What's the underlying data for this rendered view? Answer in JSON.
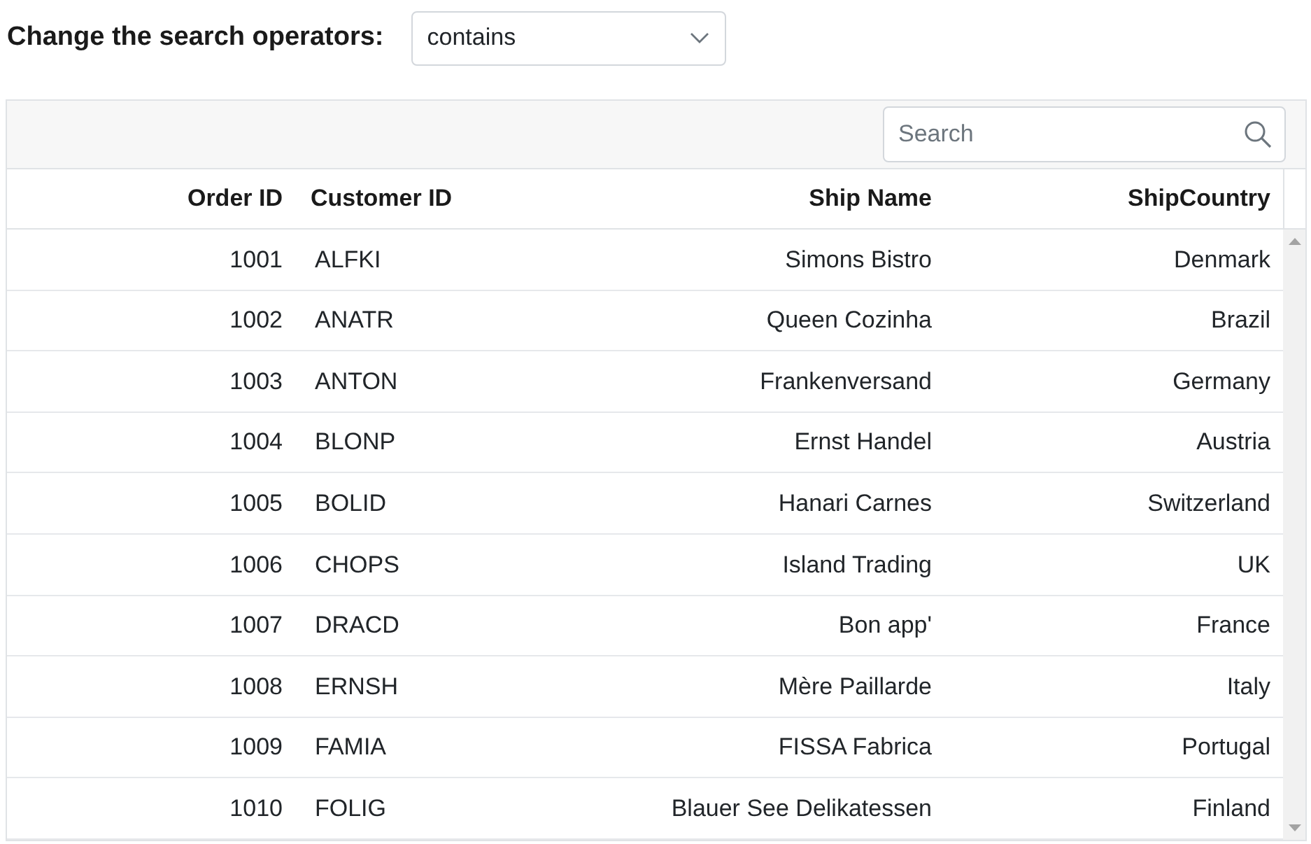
{
  "operator_selector": {
    "label": "Change the search operators:",
    "value": "contains"
  },
  "grid": {
    "search": {
      "placeholder": "Search"
    },
    "columns": [
      {
        "label": "Order ID"
      },
      {
        "label": "Customer ID"
      },
      {
        "label": "Ship Name"
      },
      {
        "label": "ShipCountry"
      }
    ],
    "rows": [
      [
        "1001",
        "ALFKI",
        "Simons Bistro",
        "Denmark"
      ],
      [
        "1002",
        "ANATR",
        "Queen Cozinha",
        "Brazil"
      ],
      [
        "1003",
        "ANTON",
        "Frankenversand",
        "Germany"
      ],
      [
        "1004",
        "BLONP",
        "Ernst Handel",
        "Austria"
      ],
      [
        "1005",
        "BOLID",
        "Hanari Carnes",
        "Switzerland"
      ],
      [
        "1006",
        "CHOPS",
        "Island Trading",
        "UK"
      ],
      [
        "1007",
        "DRACD",
        "Bon app'",
        "France"
      ],
      [
        "1008",
        "ERNSH",
        "Mère Paillarde",
        "Italy"
      ],
      [
        "1009",
        "FAMIA",
        "FISSA Fabrica",
        "Portugal"
      ],
      [
        "1010",
        "FOLIG",
        "Blauer See Delikatessen",
        "Finland"
      ]
    ]
  }
}
